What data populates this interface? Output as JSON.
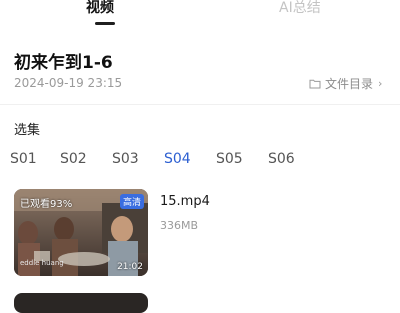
{
  "tabs": {
    "video": "视频",
    "ai_summary": "AI总结"
  },
  "header": {
    "title": "初来乍到1-6",
    "timestamp": "2024-09-19 23:15",
    "file_dir": "文件目录"
  },
  "episodes_label": "选集",
  "seasons": [
    "S01",
    "S02",
    "S03",
    "S04",
    "S05",
    "S06"
  ],
  "active_season": "S04",
  "accent_color": "#2c5fd1",
  "episode": {
    "watched": "已观看93%",
    "quality": "高清",
    "duration": "21:02",
    "watermark": "eddie huang",
    "name": "15.mp4",
    "size": "336MB"
  },
  "icons": {
    "folder": "folder-icon",
    "chevron": "chevron-right-icon"
  }
}
